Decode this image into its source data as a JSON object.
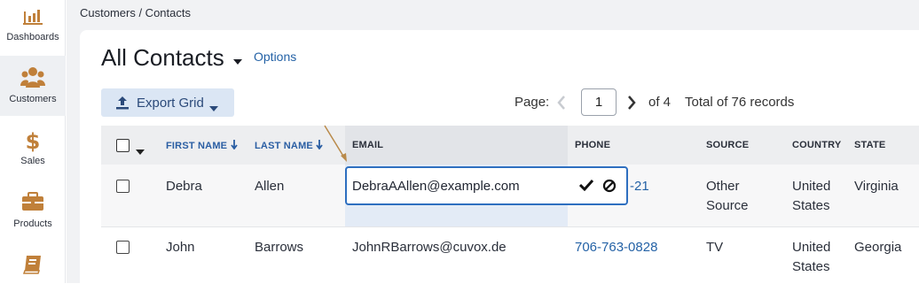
{
  "breadcrumb": "Customers / Contacts",
  "sidebar": {
    "items": [
      {
        "label": "Dashboards",
        "icon": "bar-chart-icon",
        "active": false
      },
      {
        "label": "Customers",
        "icon": "people-icon",
        "active": true
      },
      {
        "label": "Sales",
        "icon": "dollar-icon",
        "active": false
      },
      {
        "label": "Products",
        "icon": "briefcase-icon",
        "active": false
      },
      {
        "label": "",
        "icon": "book-icon",
        "active": false
      }
    ]
  },
  "header": {
    "title": "All Contacts",
    "options_label": "Options"
  },
  "toolbar": {
    "export_label": "Export Grid"
  },
  "pager": {
    "page_label": "Page:",
    "current_page": "1",
    "of_label": "of 4",
    "total_label": "Total of 76 records"
  },
  "grid": {
    "columns": [
      "FIRST NAME",
      "LAST NAME",
      "EMAIL",
      "PHONE",
      "SOURCE",
      "COUNTRY",
      "STATE"
    ],
    "rows": [
      {
        "first": "Debra",
        "last": "Allen",
        "email": "DebraAAllen@example.com",
        "phone": "-21",
        "source_1": "Other",
        "source_2": "Source",
        "country_1": "United",
        "country_2": "States",
        "state": "Virginia"
      },
      {
        "first": "John",
        "last": "Barrows",
        "email": "JohnRBarrows@cuvox.de",
        "phone": "706-763-0828",
        "source_1": "TV",
        "source_2": "",
        "country_1": "United",
        "country_2": "States",
        "state": "Georgia"
      }
    ],
    "editing_value": "DebraAAllen@example.com"
  },
  "colors": {
    "accent": "#2462a6",
    "icon_orange": "#c0803a",
    "edit_border": "#2e6fc0",
    "active_column": "#e3ebf6"
  }
}
